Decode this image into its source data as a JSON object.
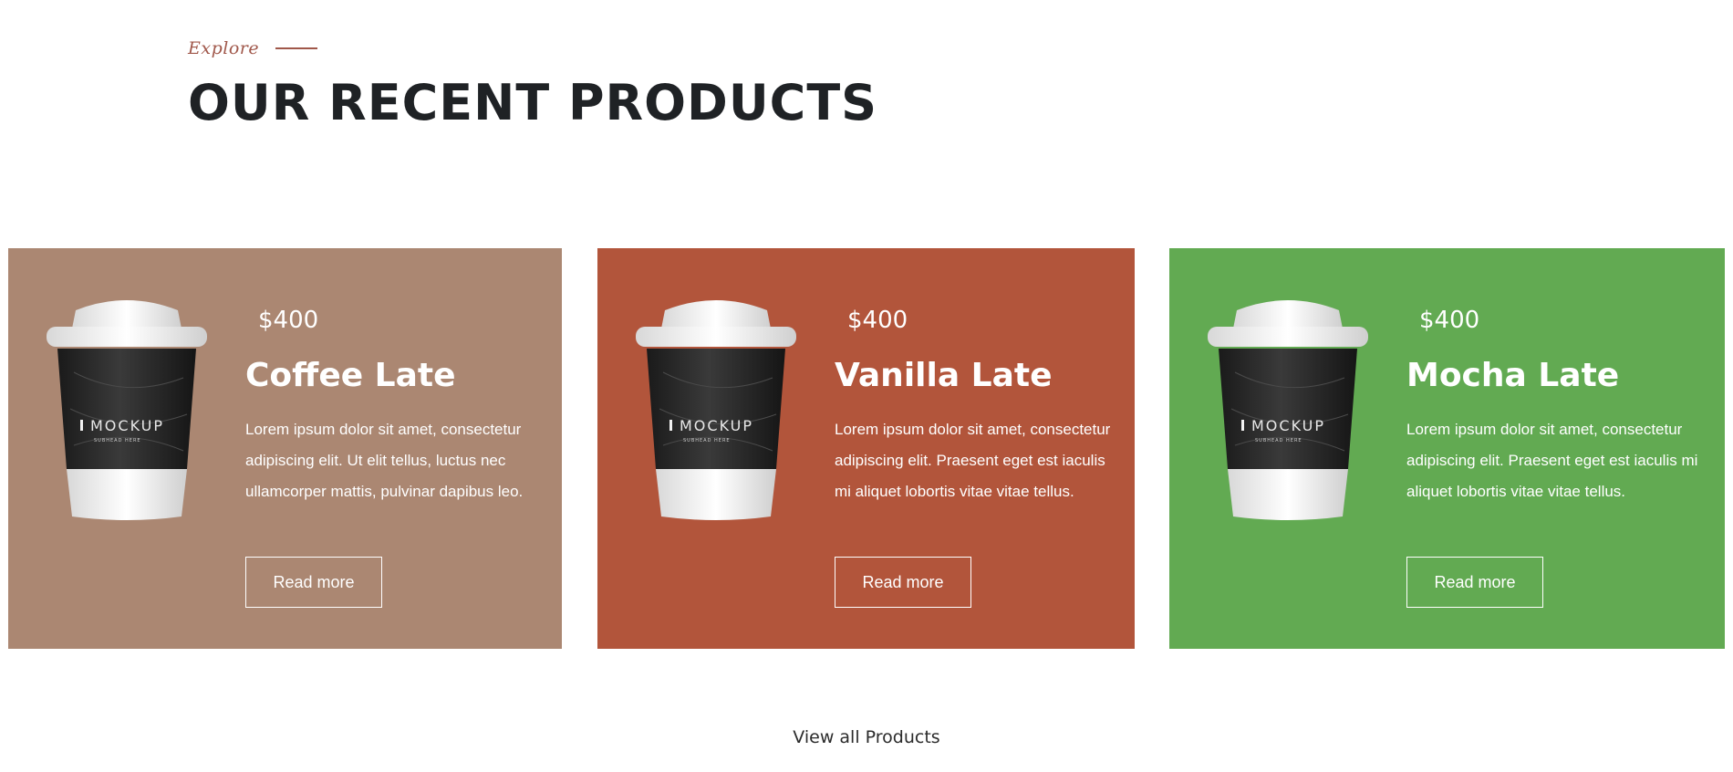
{
  "header": {
    "eyebrow": "Explore",
    "title": "OUR RECENT PRODUCTS",
    "accent_color": "#a0574a"
  },
  "products": [
    {
      "price": "$400",
      "name": "Coffee Late",
      "description": "Lorem ipsum dolor sit amet, consectetur adipiscing elit. Ut elit tellus, luctus nec ullamcorper mattis, pulvinar dapibus leo.",
      "button_label": "Read more",
      "bg_color": "#ab8772",
      "cup_text": "MOCKUP",
      "cup_subtext": "SUBHEAD HERE"
    },
    {
      "price": "$400",
      "name": "Vanilla Late",
      "description": "Lorem ipsum dolor sit amet, consectetur adipiscing elit. Praesent eget est iaculis mi aliquet lobortis vitae vitae tellus.",
      "button_label": "Read more",
      "bg_color": "#b2553b",
      "cup_text": "MOCKUP",
      "cup_subtext": "SUBHEAD HERE"
    },
    {
      "price": "$400",
      "name": "Mocha Late",
      "description": "Lorem ipsum dolor sit amet, consectetur adipiscing elit. Praesent eget est iaculis mi aliquet lobortis vitae vitae tellus.",
      "button_label": "Read more",
      "bg_color": "#62aa52",
      "cup_text": "MOCKUP",
      "cup_subtext": "SUBHEAD HERE"
    }
  ],
  "footer": {
    "view_all_label": "View all Products"
  }
}
